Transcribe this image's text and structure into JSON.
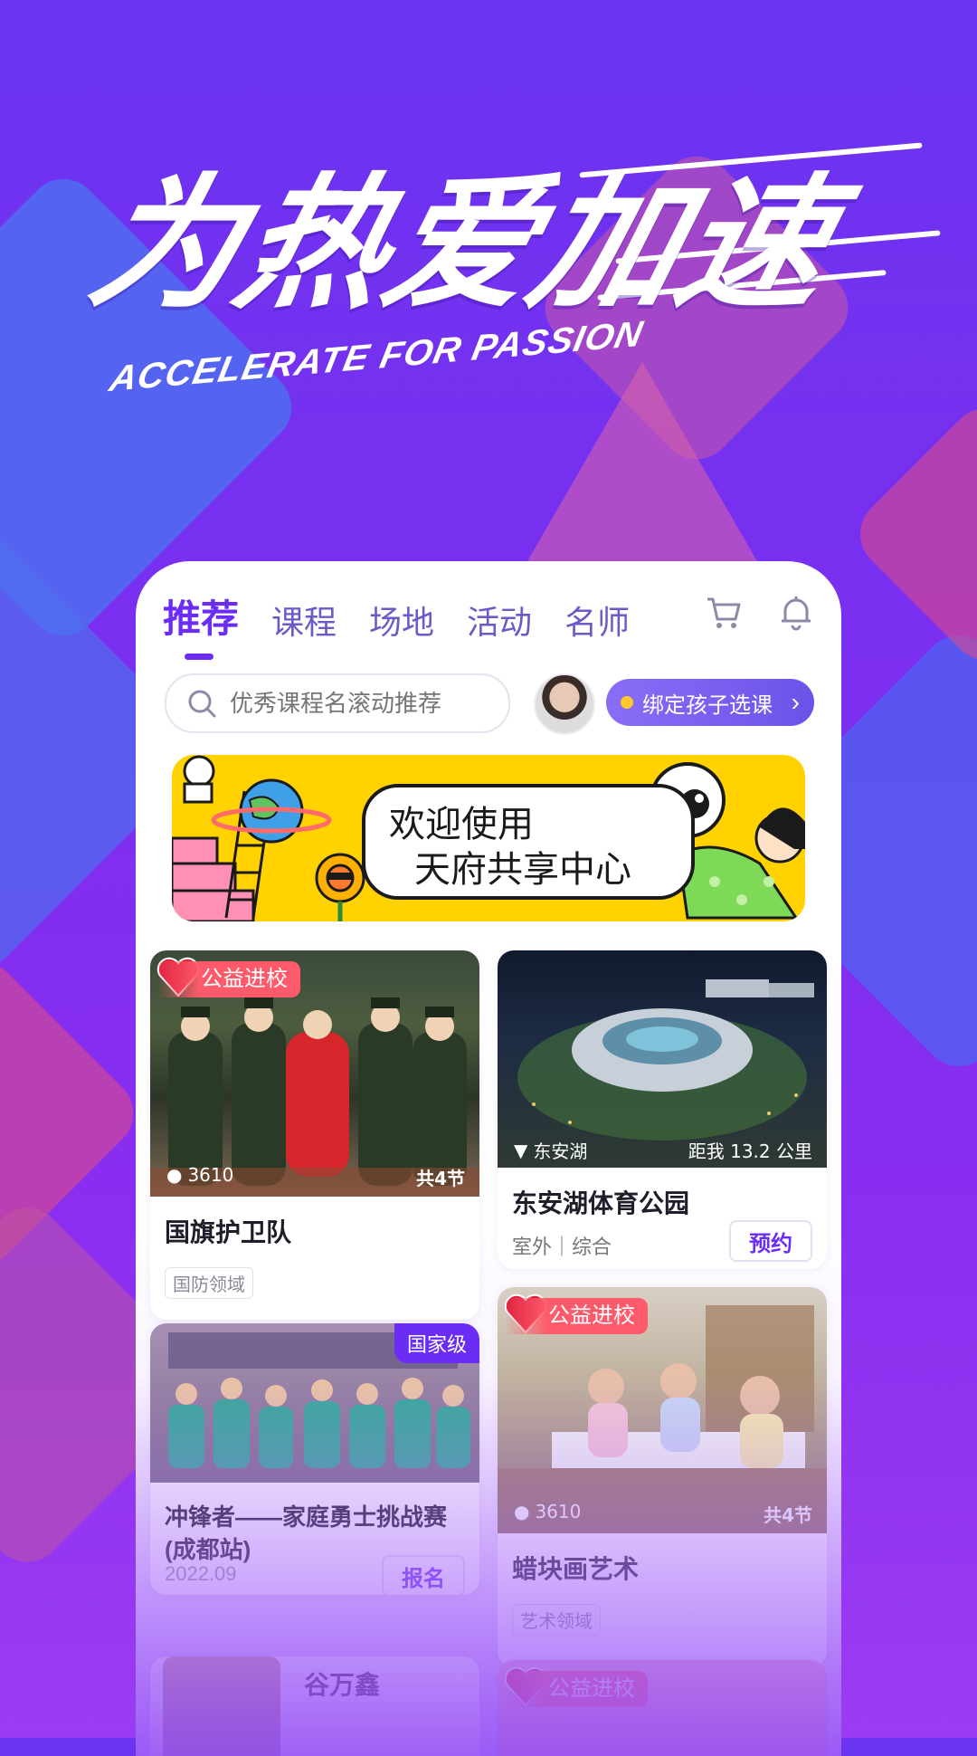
{
  "hero": {
    "title": "为热爱加速",
    "subtitle": "ACCELERATE FOR PASSION"
  },
  "tabs": [
    {
      "label": "推荐",
      "active": true
    },
    {
      "label": "课程",
      "active": false
    },
    {
      "label": "场地",
      "active": false
    },
    {
      "label": "活动",
      "active": false
    },
    {
      "label": "名师",
      "active": false
    }
  ],
  "icons": {
    "cart": "cart-icon",
    "bell": "bell-icon",
    "search": "search-icon"
  },
  "search": {
    "placeholder": "优秀课程名滚动推荐"
  },
  "bind_button": {
    "label": "绑定孩子选课"
  },
  "banner": {
    "line1": "欢迎使用",
    "line2": "天府共享中心"
  },
  "cards": {
    "flag_guard": {
      "tag": "公益进校",
      "views": "3610",
      "lessons": "共4节",
      "title": "国旗护卫队",
      "category": "国防领域"
    },
    "park": {
      "location": "东安湖",
      "distance": "距我 13.2 公里",
      "title": "东安湖体育公园",
      "meta": "室外｜综合",
      "button": "预约"
    },
    "challenge": {
      "level": "国家级",
      "title": "冲锋者——家庭勇士挑战赛(成都站)",
      "date": "2022.09",
      "button": "报名"
    },
    "crayon": {
      "tag": "公益进校",
      "views": "3610",
      "lessons": "共4节",
      "title": "蜡块画艺术",
      "category": "艺术领域"
    },
    "teacher": {
      "name": "谷万鑫"
    },
    "bottom_right": {
      "tag": "公益进校"
    }
  },
  "colors": {
    "accent": "#6b2cf5",
    "background": "#7a2ff0",
    "banner": "#ffd200",
    "tag_red": "#ff5a6b"
  }
}
